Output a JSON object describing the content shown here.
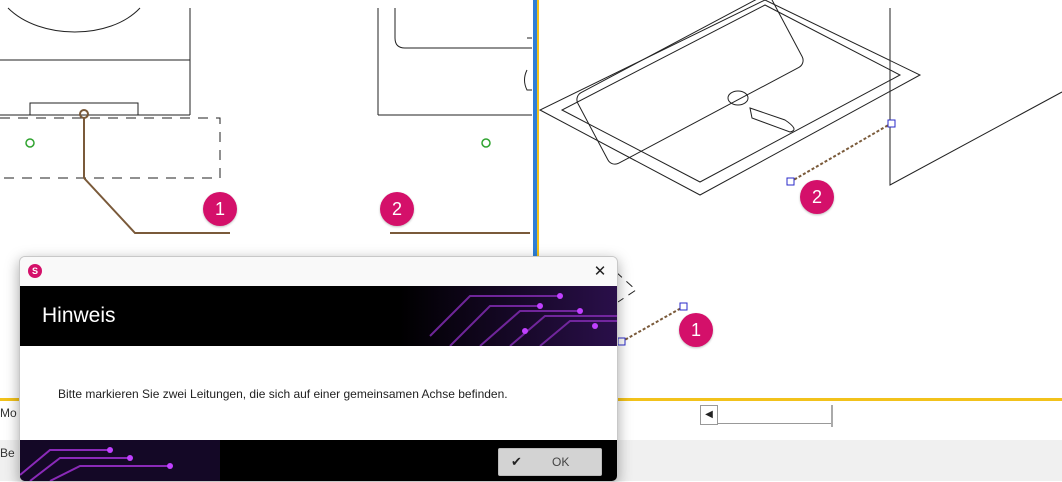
{
  "markers": {
    "left_view_1": "1",
    "left_view_2": "2",
    "iso_view_2": "2",
    "iso_view_1": "1"
  },
  "background": {
    "stub_top": "Mo",
    "stub_bottom": "Be"
  },
  "dialog": {
    "title": "Hinweis",
    "message": "Bitte markieren Sie zwei Leitungen, die sich auf einer gemeinsamen Achse befinden.",
    "ok_label": "OK",
    "close_icon": "close-icon",
    "confirm_icon": "checkmark-icon",
    "app_icon_letter": "S"
  },
  "colors": {
    "marker": "#d4106a",
    "pipe": "#7a5a3a",
    "accent_yellow": "#f2c21b",
    "divider_blue": "#2f7fd6"
  }
}
